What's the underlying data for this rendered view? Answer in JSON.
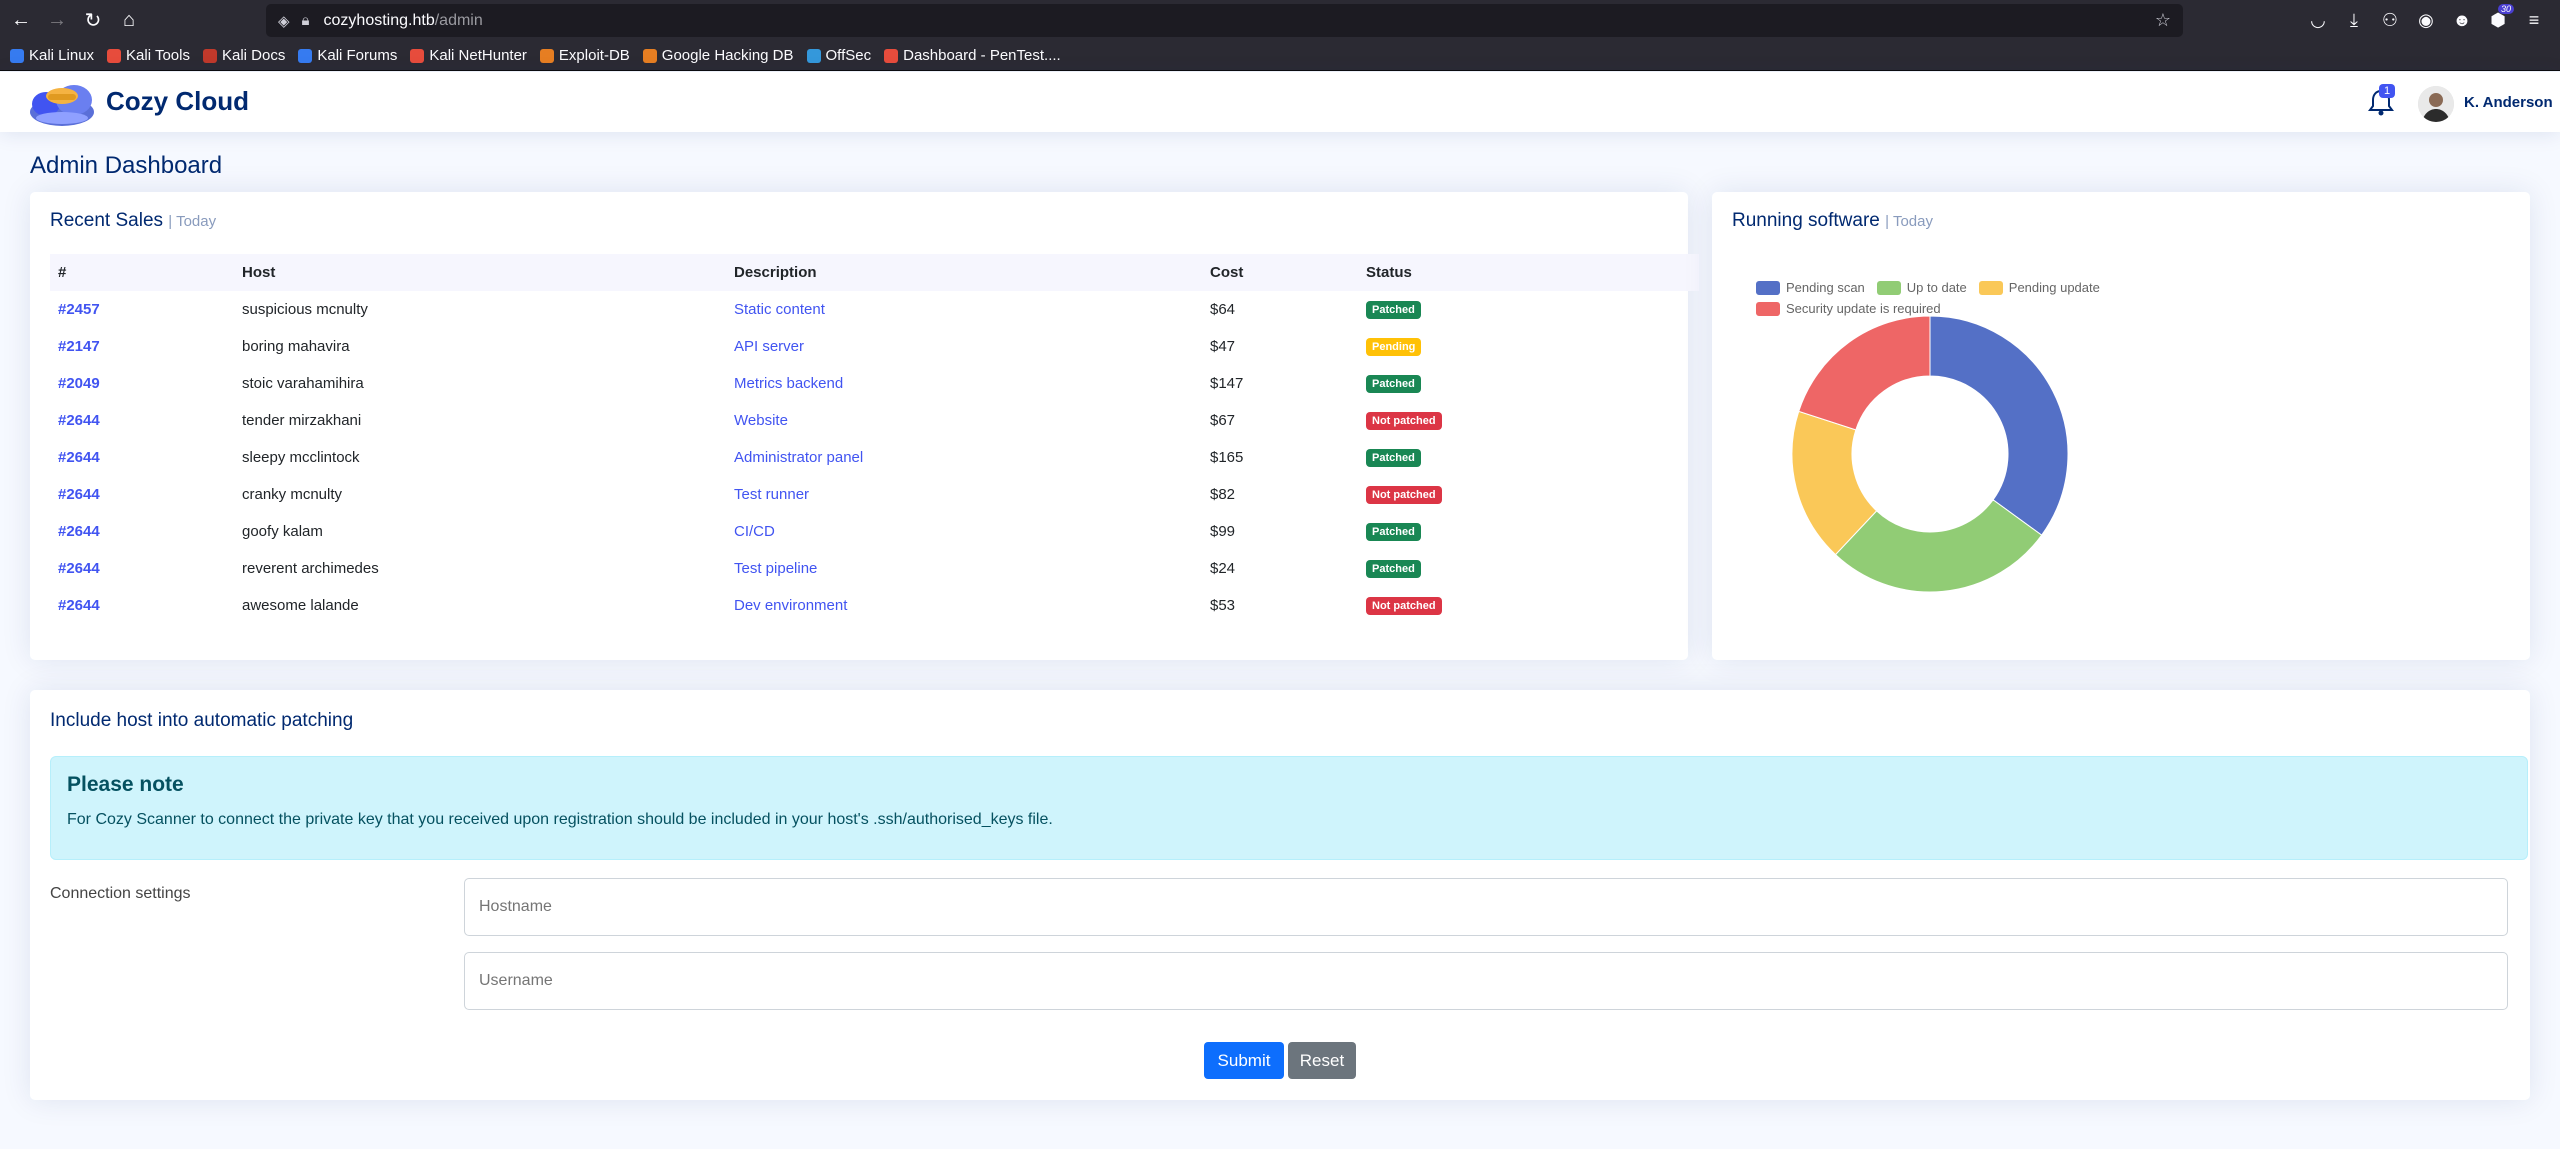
{
  "browser": {
    "url_host": "cozyhosting.htb",
    "url_path": "/admin",
    "extension_badge": "30",
    "bookmarks": [
      {
        "label": "Kali Linux",
        "color": "#367bf0"
      },
      {
        "label": "Kali Tools",
        "color": "#e74c3c"
      },
      {
        "label": "Kali Docs",
        "color": "#c0392b"
      },
      {
        "label": "Kali Forums",
        "color": "#367bf0"
      },
      {
        "label": "Kali NetHunter",
        "color": "#e74c3c"
      },
      {
        "label": "Exploit-DB",
        "color": "#e67e22"
      },
      {
        "label": "Google Hacking DB",
        "color": "#e67e22"
      },
      {
        "label": "OffSec",
        "color": "#3498db"
      },
      {
        "label": "Dashboard - PenTest....",
        "color": "#e74c3c"
      }
    ]
  },
  "header": {
    "brand": "Cozy Cloud",
    "notification_count": "1",
    "user_name": "K. Anderson"
  },
  "page": {
    "title": "Admin Dashboard"
  },
  "sales": {
    "title": "Recent Sales",
    "subtitle": "| Today",
    "columns": [
      "#",
      "Host",
      "Description",
      "Cost",
      "Status"
    ],
    "rows": [
      {
        "id": "#2457",
        "host": "suspicious mcnulty",
        "desc": "Static content",
        "cost": "$64",
        "status": "Patched",
        "kind": "success"
      },
      {
        "id": "#2147",
        "host": "boring mahavira",
        "desc": "API server",
        "cost": "$47",
        "status": "Pending",
        "kind": "warning"
      },
      {
        "id": "#2049",
        "host": "stoic varahamihira",
        "desc": "Metrics backend",
        "cost": "$147",
        "status": "Patched",
        "kind": "success"
      },
      {
        "id": "#2644",
        "host": "tender mirzakhani",
        "desc": "Website",
        "cost": "$67",
        "status": "Not patched",
        "kind": "danger"
      },
      {
        "id": "#2644",
        "host": "sleepy mcclintock",
        "desc": "Administrator panel",
        "cost": "$165",
        "status": "Patched",
        "kind": "success"
      },
      {
        "id": "#2644",
        "host": "cranky mcnulty",
        "desc": "Test runner",
        "cost": "$82",
        "status": "Not patched",
        "kind": "danger"
      },
      {
        "id": "#2644",
        "host": "goofy kalam",
        "desc": "CI/CD",
        "cost": "$99",
        "status": "Patched",
        "kind": "success"
      },
      {
        "id": "#2644",
        "host": "reverent archimedes",
        "desc": "Test pipeline",
        "cost": "$24",
        "status": "Patched",
        "kind": "success"
      },
      {
        "id": "#2644",
        "host": "awesome lalande",
        "desc": "Dev environment",
        "cost": "$53",
        "status": "Not patched",
        "kind": "danger"
      }
    ]
  },
  "software": {
    "title": "Running software",
    "subtitle": "| Today"
  },
  "chart_data": {
    "type": "pie",
    "variant": "doughnut",
    "categories": [
      "Pending scan",
      "Up to date",
      "Pending update",
      "Security update is required"
    ],
    "values": [
      35,
      27,
      18,
      20
    ],
    "colors": [
      "#5470c6",
      "#91cc75",
      "#fac858",
      "#ee6666"
    ],
    "legend": "top"
  },
  "patching": {
    "title": "Include host into automatic patching",
    "note_heading": "Please note",
    "note_text": "For Cozy Scanner to connect the private key that you received upon registration should be included in your host's .ssh/authorised_keys file.",
    "connection_label": "Connection settings",
    "hostname_placeholder": "Hostname",
    "username_placeholder": "Username",
    "submit_label": "Submit",
    "reset_label": "Reset"
  }
}
